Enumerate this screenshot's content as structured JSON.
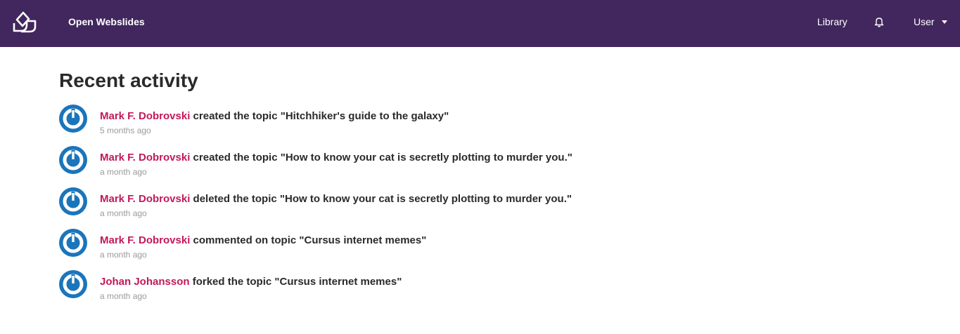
{
  "header": {
    "brand": "Open Webslides",
    "library": "Library",
    "user": "User",
    "background": "#42275e"
  },
  "page": {
    "title": "Recent activity"
  },
  "activities": [
    {
      "user": "Mark F. Dobrovski",
      "action": " created the topic \"Hitchhiker's guide to the galaxy\"",
      "time": "5 months ago"
    },
    {
      "user": "Mark F. Dobrovski",
      "action": " created the topic \"How to know your cat is secretly plotting to murder you.\"",
      "time": "a month ago"
    },
    {
      "user": "Mark F. Dobrovski",
      "action": " deleted the topic \"How to know your cat is secretly plotting to murder you.\"",
      "time": "a month ago"
    },
    {
      "user": "Mark F. Dobrovski",
      "action": " commented on topic \"Cursus internet memes\"",
      "time": "a month ago"
    },
    {
      "user": "Johan Johansson",
      "action": " forked the topic \"Cursus internet memes\"",
      "time": "a month ago"
    }
  ],
  "colors": {
    "user_link": "#c2185b",
    "avatar": "#1a75bb",
    "muted": "#9a9a9a"
  },
  "icons": {
    "logo": "leaf-logo-icon",
    "notifications": "bell-icon",
    "user_menu": "caret-down-icon",
    "avatar": "power-avatar-icon"
  }
}
